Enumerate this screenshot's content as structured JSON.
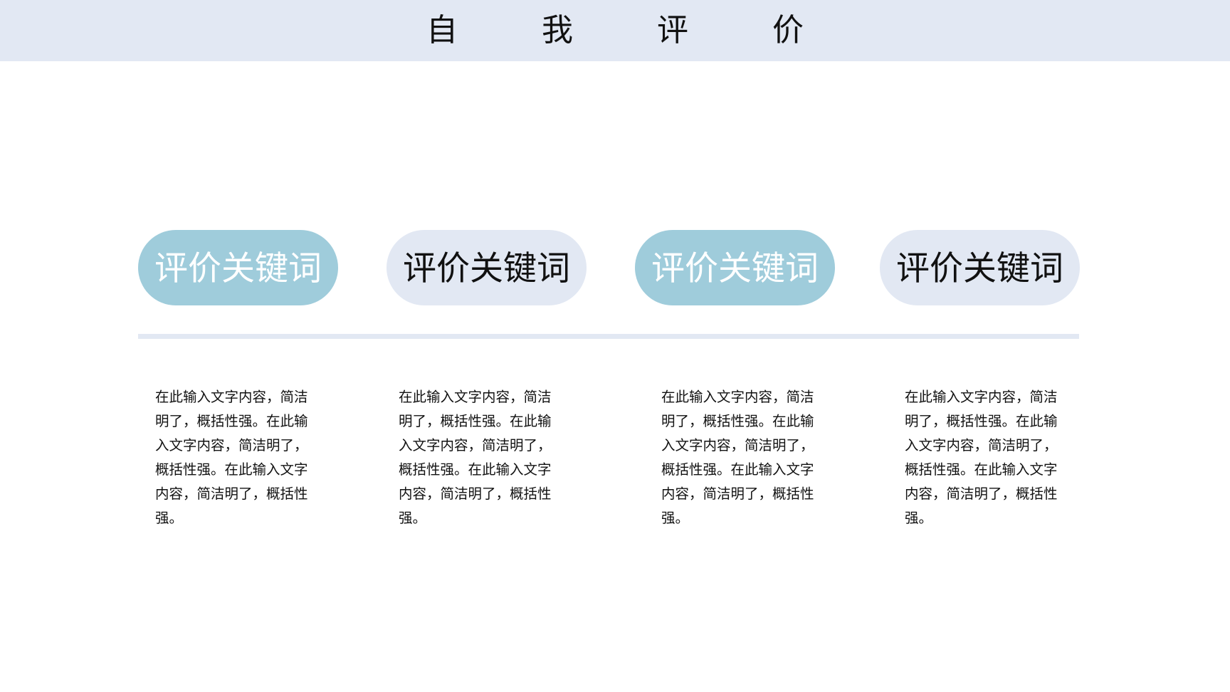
{
  "header": {
    "title": "自 我 评 价"
  },
  "cards": [
    {
      "keyword": "评价关键词",
      "description": "在此输入文字内容，简洁明了，概括性强。在此输入文字内容，简洁明了，概括性强。在此输入文字内容，简洁明了，概括性强。"
    },
    {
      "keyword": "评价关键词",
      "description": "在此输入文字内容，简洁明了，概括性强。在此输入文字内容，简洁明了，概括性强。在此输入文字内容，简洁明了，概括性强。"
    },
    {
      "keyword": "评价关键词",
      "description": "在此输入文字内容，简洁明了，概括性强。在此输入文字内容，简洁明了，概括性强。在此输入文字内容，简洁明了，概括性强。"
    },
    {
      "keyword": "评价关键词",
      "description": "在此输入文字内容，简洁明了，概括性强。在此输入文字内容，简洁明了，概括性强。在此输入文字内容，简洁明了，概括性强。"
    }
  ],
  "colors": {
    "header_bg": "#e2e8f3",
    "accent_teal": "#9fccdb",
    "accent_light": "#e2e8f3",
    "text_dark": "#111111",
    "text_light": "#ffffff"
  }
}
